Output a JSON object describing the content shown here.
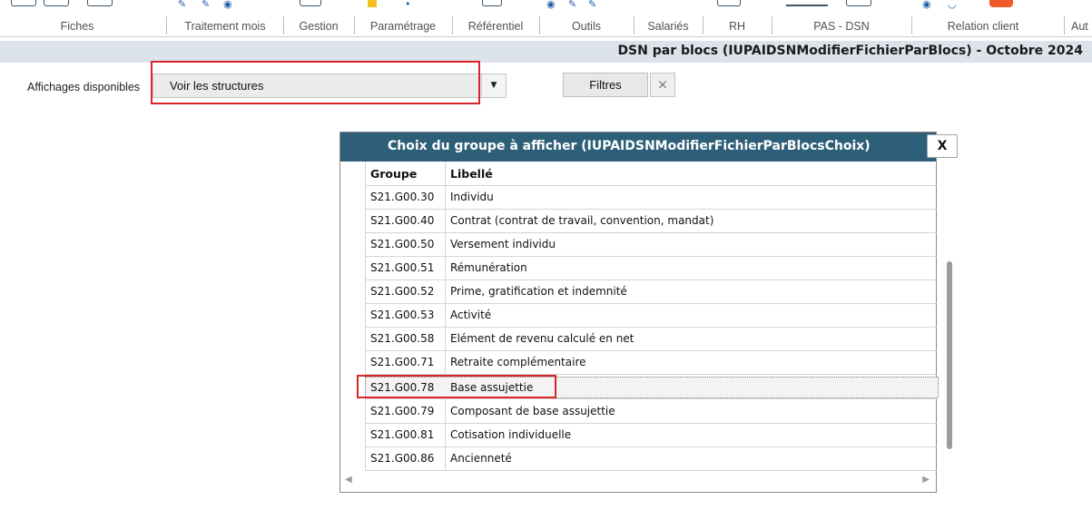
{
  "ribbon": {
    "groups": [
      {
        "label": "Fiches"
      },
      {
        "label": "Traitement mois"
      },
      {
        "label": "Gestion"
      },
      {
        "label": "Paramétrage"
      },
      {
        "label": "Référentiel"
      },
      {
        "label": "Outils"
      },
      {
        "label": "Salariés"
      },
      {
        "label": "RH"
      },
      {
        "label": "PAS - DSN"
      },
      {
        "label": "Relation client"
      },
      {
        "label": "Aut"
      }
    ]
  },
  "page": {
    "title": "DSN par blocs (IUPAIDSNModifierFichierParBlocs) - Octobre 2024"
  },
  "filters": {
    "affichages_label": "Affichages disponibles",
    "affichages_value": "Voir les structures",
    "filtres_button": "Filtres",
    "clear_icon": "×"
  },
  "dialog": {
    "title": "Choix du groupe à afficher (IUPAIDSNModifierFichierParBlocsChoix)",
    "close_label": "X",
    "columns": [
      "Groupe",
      "Libellé"
    ],
    "rows": [
      {
        "groupe": "S21.G00.30",
        "libelle": "Individu"
      },
      {
        "groupe": "S21.G00.40",
        "libelle": "Contrat (contrat de travail, convention, mandat)"
      },
      {
        "groupe": "S21.G00.50",
        "libelle": "Versement individu"
      },
      {
        "groupe": "S21.G00.51",
        "libelle": "Rémunération"
      },
      {
        "groupe": "S21.G00.52",
        "libelle": "Prime, gratification et indemnité"
      },
      {
        "groupe": "S21.G00.53",
        "libelle": "Activité"
      },
      {
        "groupe": "S21.G00.58",
        "libelle": "Elément de revenu calculé en net"
      },
      {
        "groupe": "S21.G00.71",
        "libelle": "Retraite complémentaire"
      },
      {
        "groupe": "S21.G00.78",
        "libelle": "Base assujettie"
      },
      {
        "groupe": "S21.G00.79",
        "libelle": "Composant de base assujettie"
      },
      {
        "groupe": "S21.G00.81",
        "libelle": "Cotisation individuelle"
      },
      {
        "groupe": "S21.G00.86",
        "libelle": "Ancienneté"
      }
    ],
    "selected_row": "S21.G00.78"
  },
  "colors": {
    "header_bg": "#2e5f78",
    "highlight_red": "#d9242a",
    "titlebar_bg": "#dde3ea"
  }
}
